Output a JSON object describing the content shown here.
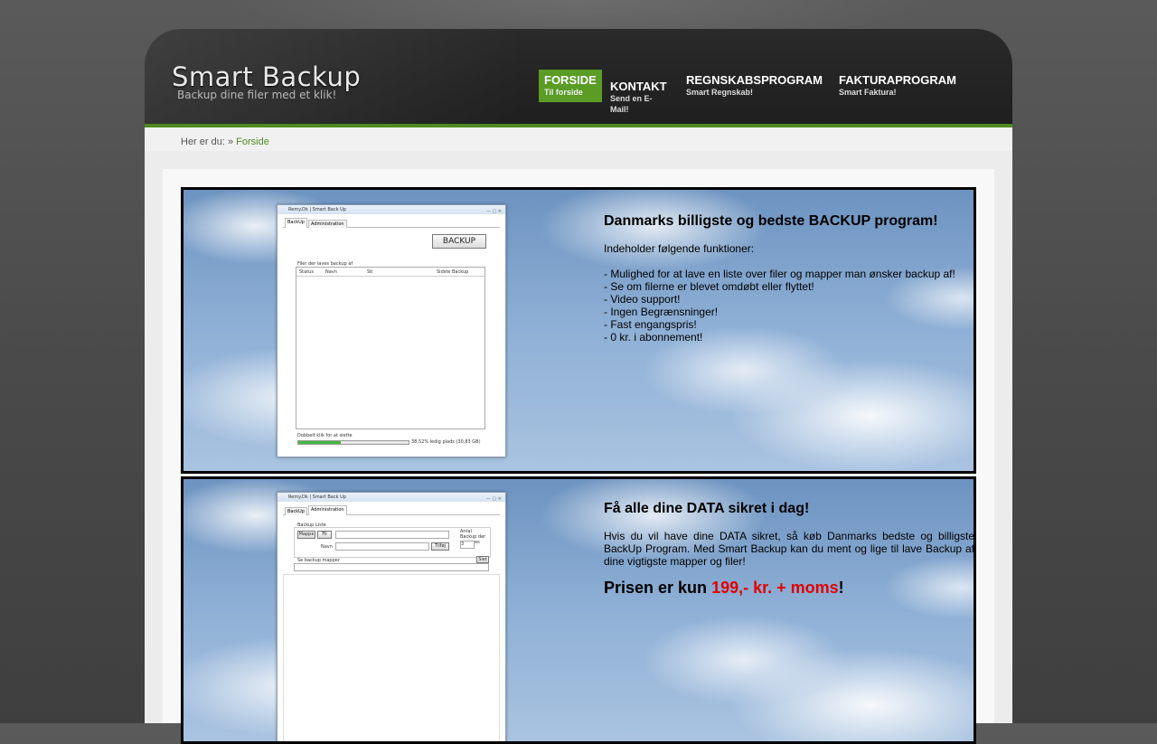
{
  "site": {
    "logo": "Smart Backup",
    "tagline": "Backup dine filer med et klik!"
  },
  "nav": [
    {
      "label": "FORSIDE",
      "sub": "Til forside",
      "active": true
    },
    {
      "label": "KONTAKT",
      "sub": "Send en E-Mail!",
      "active": false
    },
    {
      "label": "REGNSKABSPROGRAM",
      "sub": "Smart Regnskab!",
      "active": false
    },
    {
      "label": "FAKTURAPROGRAM",
      "sub": "Smart Faktura!",
      "active": false
    }
  ],
  "breadcrumb": {
    "prefix": "Her er du: »",
    "current": "Forside"
  },
  "panel1": {
    "screenshot": {
      "title": "Remy.Dk | Smart Back Up",
      "controls": "— ▢ ✕",
      "tabs": [
        "BackUp",
        "Administration"
      ],
      "backup_button": "BACKUP",
      "list_label": "Filer der laves backup af",
      "columns": [
        "Status",
        "Navn",
        "Sti",
        "Sidste Backup"
      ],
      "hint": "Dobbelt klik for at slette",
      "progress_fraction": 0.385,
      "free_space": "38,52% ledig plads (30,83 GB)"
    },
    "heading": "Danmarks billigste og bedste BACKUP program!",
    "intro": "Indeholder følgende funktioner:",
    "features": [
      "- Mulighed for at lave en liste over filer og mapper man ønsker backup af!",
      "- Se om filerne er blevet omdøbt eller flyttet!",
      "- Video support!",
      "- Ingen Begrænsninger!",
      "- Fast engangspris!",
      "- 0 kr. i abonnement!"
    ]
  },
  "panel2": {
    "screenshot": {
      "title": "Remy.Dk | Smart Back Up",
      "controls": "— ▢ ✕",
      "tabs": [
        "BackUp",
        "Administration"
      ],
      "group_label": "Backup Liste",
      "btn_mappe": "Mappe",
      "btn_fil": "Fil",
      "navn_label": "Navn",
      "btn_tilfoj": "Tilføj",
      "antal_label": "Antal Backup der gemmes",
      "antal_value": "3",
      "mapper_label": "Se backup mapper",
      "btn_slet": "Slet"
    },
    "heading": "Få alle dine DATA sikret i dag!",
    "text": "Hvis du vil have dine DATA sikret, så køb Danmarks bedste og billigste BackUp Program. Med Smart Backup kan du ment og lige til lave Backup af dine vigtigste mapper og filer!",
    "price_prefix": "Prisen er kun ",
    "price_value": "199,- kr. + moms",
    "price_suffix": "!"
  },
  "colors": {
    "accent_green": "#5a9c24",
    "price_red": "#e00000"
  }
}
